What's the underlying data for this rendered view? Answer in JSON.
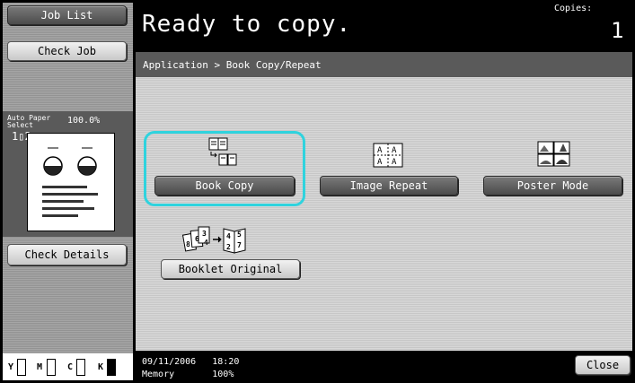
{
  "header": {
    "status": "Ready to copy.",
    "copies_label": "Copies:",
    "copies_value": "1"
  },
  "left": {
    "job_list": "Job List",
    "check_job": "Check Job",
    "paper_line1": "Auto Paper",
    "paper_line2": "Select",
    "zoom": "100.0%",
    "duplex_icon": "1▯2",
    "check_details": "Check Details"
  },
  "toner": {
    "labels": [
      "Y",
      "M",
      "C",
      "K"
    ],
    "colors": [
      "#ffffff",
      "#ffffff",
      "#ffffff",
      "#000000"
    ]
  },
  "main": {
    "breadcrumb": "Application > Book Copy/Repeat",
    "functions": [
      {
        "label": "Book Copy",
        "icon": "book-copy-icon",
        "selected": true
      },
      {
        "label": "Image Repeat",
        "icon": "image-repeat-icon",
        "selected": false
      },
      {
        "label": "Poster Mode",
        "icon": "poster-mode-icon",
        "selected": false
      },
      {
        "label": "Booklet Original",
        "icon": "booklet-original-icon",
        "selected": false
      }
    ],
    "selection_color": "#2fd3de"
  },
  "footer": {
    "datetime": "09/11/2006   18:20",
    "memory": "Memory       100%",
    "close": "Close"
  }
}
